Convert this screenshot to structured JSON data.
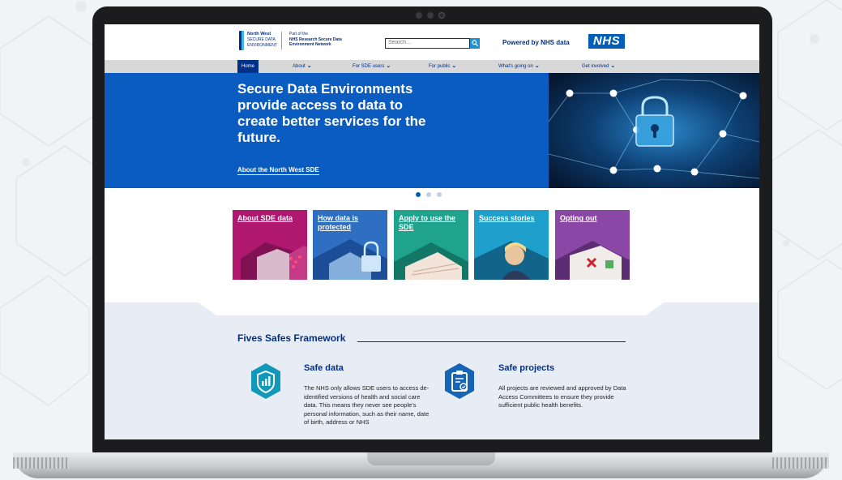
{
  "header": {
    "logo_line1": "North West",
    "logo_line2": "SECURE DATA",
    "logo_line3": "ENVIRONMENT",
    "partof_line1": "Part of the",
    "partof_line2": "NHS Research Secure Data",
    "partof_line3": "Environment Network",
    "search_placeholder": "Search...",
    "powered_by": "Powered by NHS data",
    "nhs_logo": "NHS"
  },
  "nav": {
    "items": [
      {
        "label": "Home"
      },
      {
        "label": "About",
        "chev": "⌄"
      },
      {
        "label": "For SDE users",
        "chev": "⌄"
      },
      {
        "label": "For public",
        "chev": "⌄"
      },
      {
        "label": "What's going on",
        "chev": "⌄"
      },
      {
        "label": "Get involved",
        "chev": "⌄"
      }
    ]
  },
  "hero": {
    "headline": "Secure Data Environments provide access to data to create better services for the future.",
    "link": "About the North West SDE",
    "slides_total": 3,
    "slides_active": 1
  },
  "cards": [
    {
      "label": "About SDE data",
      "color": "#b0186f"
    },
    {
      "label": "How data is protected",
      "color": "#2f6fc2"
    },
    {
      "label": "Apply to use the SDE",
      "color": "#1fa38d"
    },
    {
      "label": "Success stories",
      "color": "#1e9fcc"
    },
    {
      "label": "Opting out",
      "color": "#8b47a5"
    }
  ],
  "framework": {
    "title": "Fives Safes Framework",
    "items": [
      {
        "title": "Safe data",
        "icon": "chart-shield-icon",
        "text": "The NHS only allows SDE users to access de-identified versions of health and social care data. This means they never see people's personal information, such as their name, date of birth, address or NHS"
      },
      {
        "title": "Safe projects",
        "icon": "clipboard-check-icon",
        "text": "All projects are reviewed and approved by Data Access Committees to ensure they provide sufficient public health benefits."
      }
    ]
  },
  "colors": {
    "nhs_blue": "#005eb8",
    "hero_blue": "#0a5cc0",
    "navy": "#003087",
    "teal": "#1298b8"
  }
}
